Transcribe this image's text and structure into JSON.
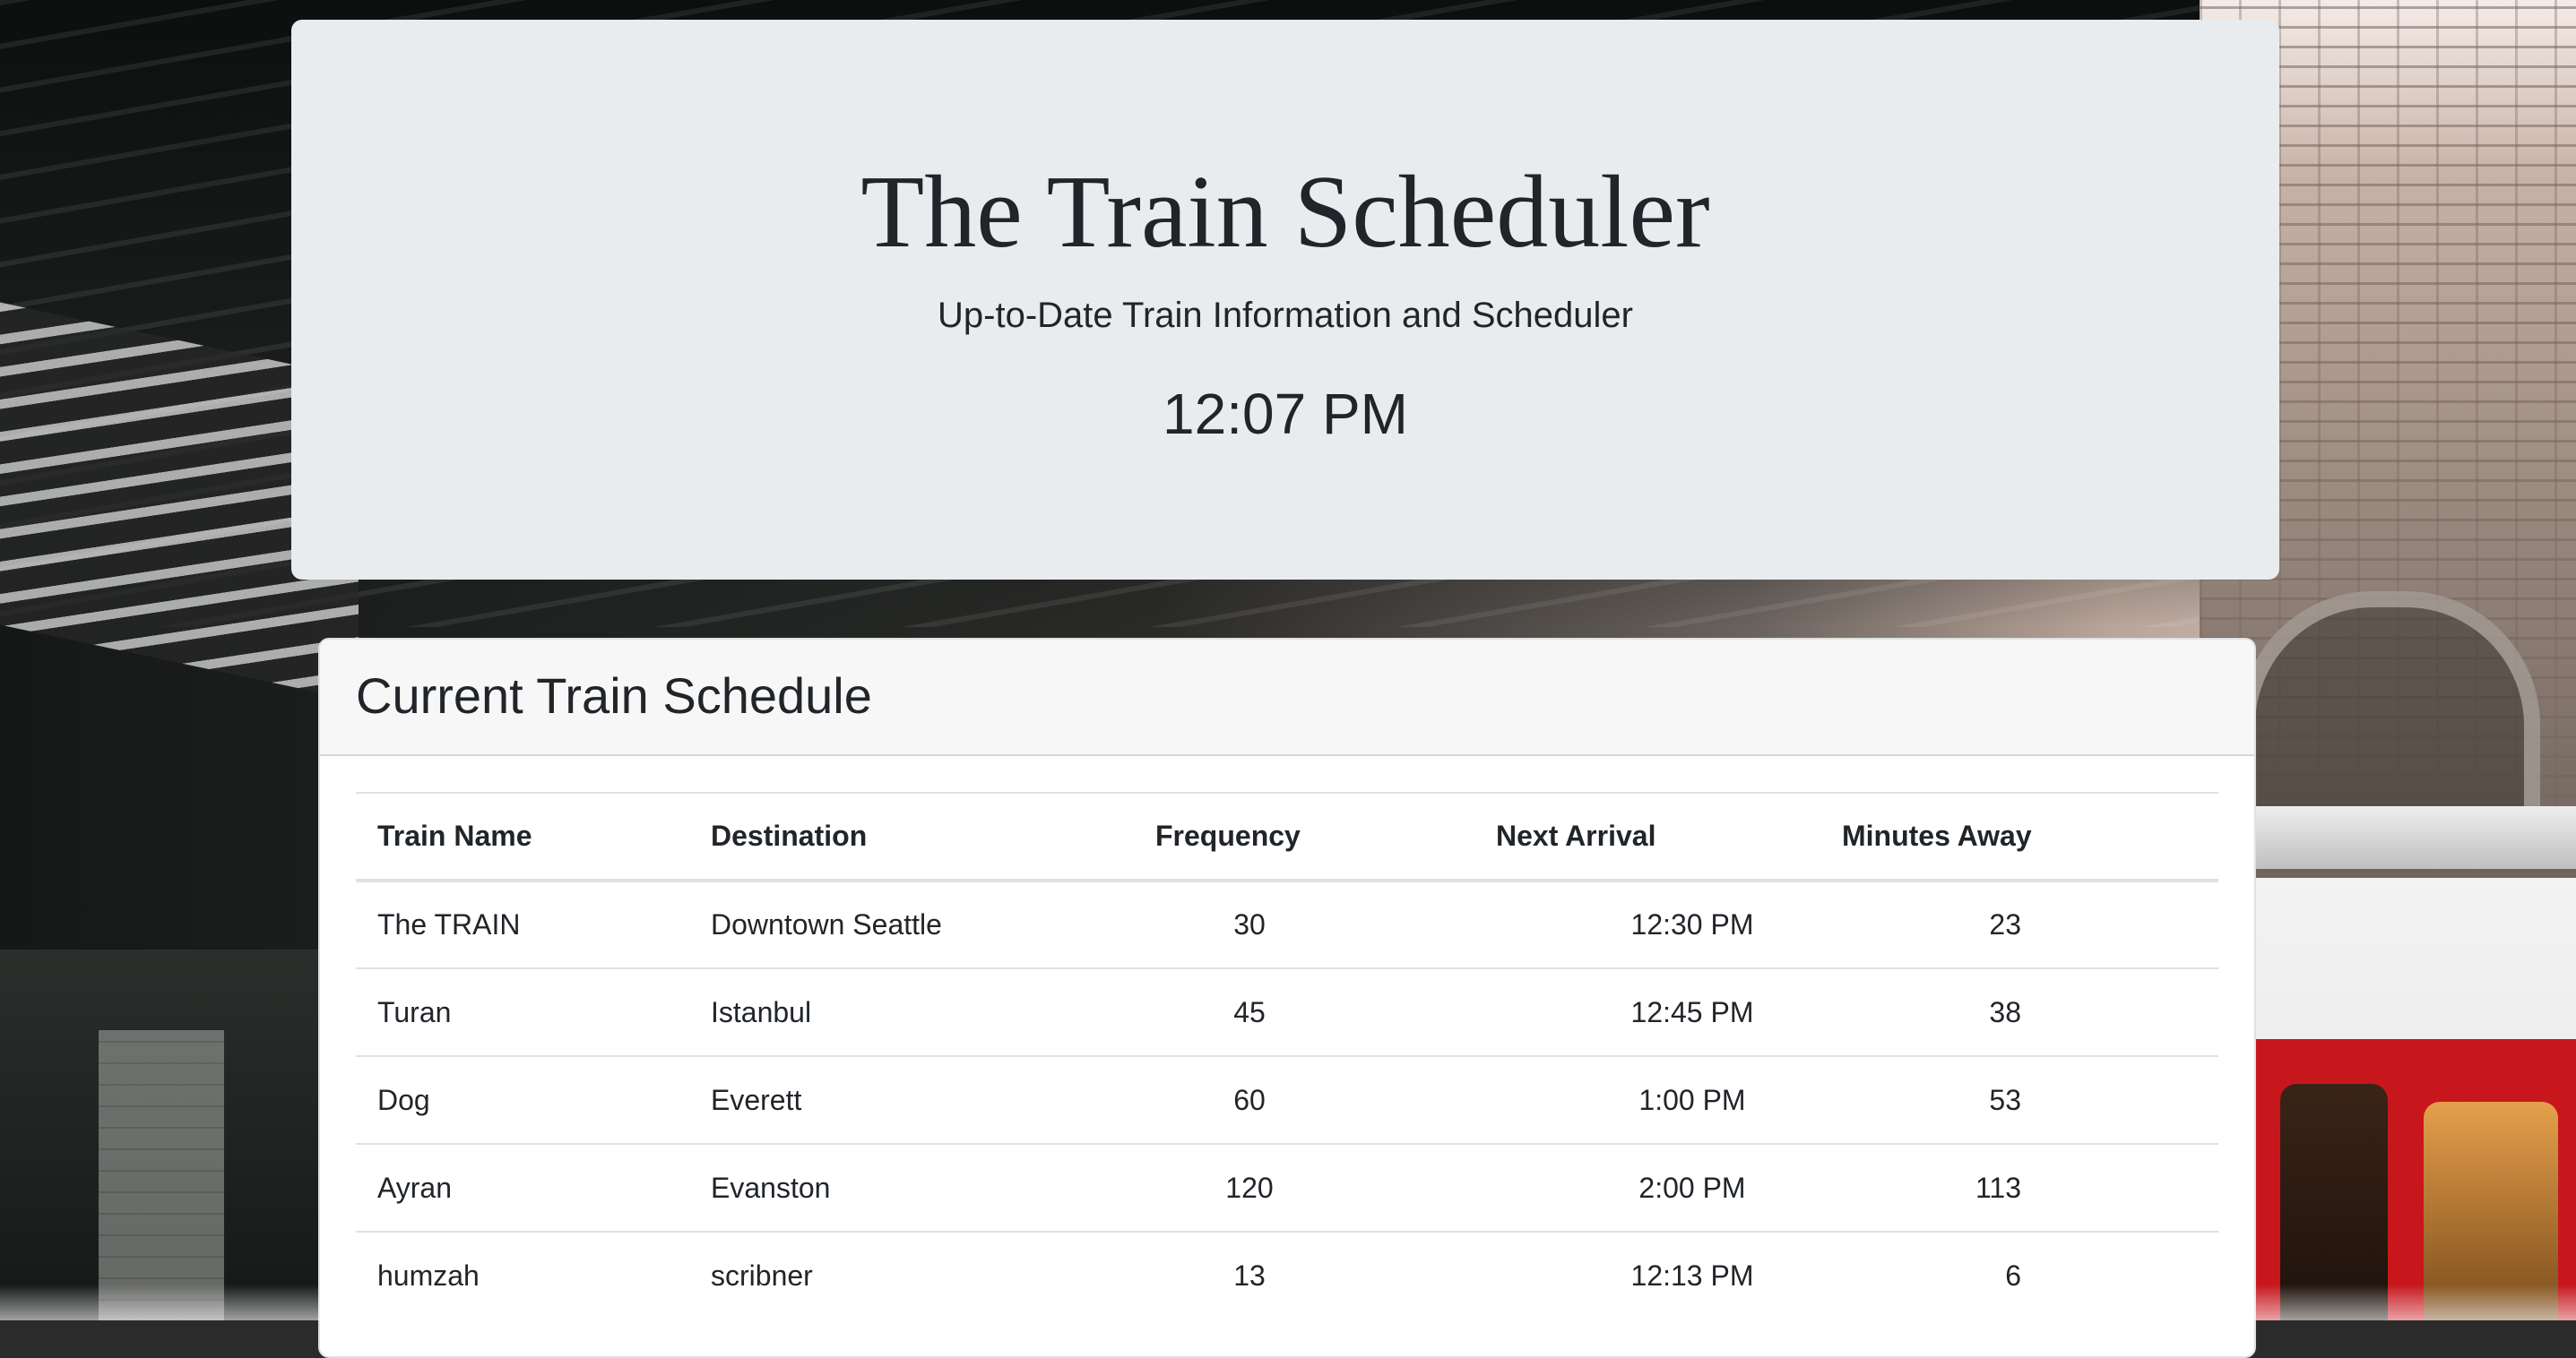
{
  "header": {
    "title": "The Train Scheduler",
    "subtitle": "Up-to-Date Train Information and Scheduler",
    "clock": "12:07 PM"
  },
  "schedule": {
    "title": "Current Train Schedule",
    "columns": [
      "Train Name",
      "Destination",
      "Frequency",
      "Next Arrival",
      "Minutes Away"
    ],
    "rows": [
      [
        "The TRAIN",
        "Downtown Seattle",
        "30",
        "12:30 PM",
        "23"
      ],
      [
        "Turan",
        "Istanbul",
        "45",
        "12:45 PM",
        "38"
      ],
      [
        "Dog",
        "Everett",
        "60",
        "1:00 PM",
        "53"
      ],
      [
        "Ayran",
        "Evanston",
        "120",
        "2:00 PM",
        "113"
      ],
      [
        "humzah",
        "scribner",
        "13",
        "12:13 PM",
        "6"
      ]
    ]
  },
  "colors": {
    "jumbotron_bg": "#e9ecef",
    "card_header_bg": "#f7f7f7",
    "text": "#212529",
    "table_border": "#dee2e6"
  }
}
